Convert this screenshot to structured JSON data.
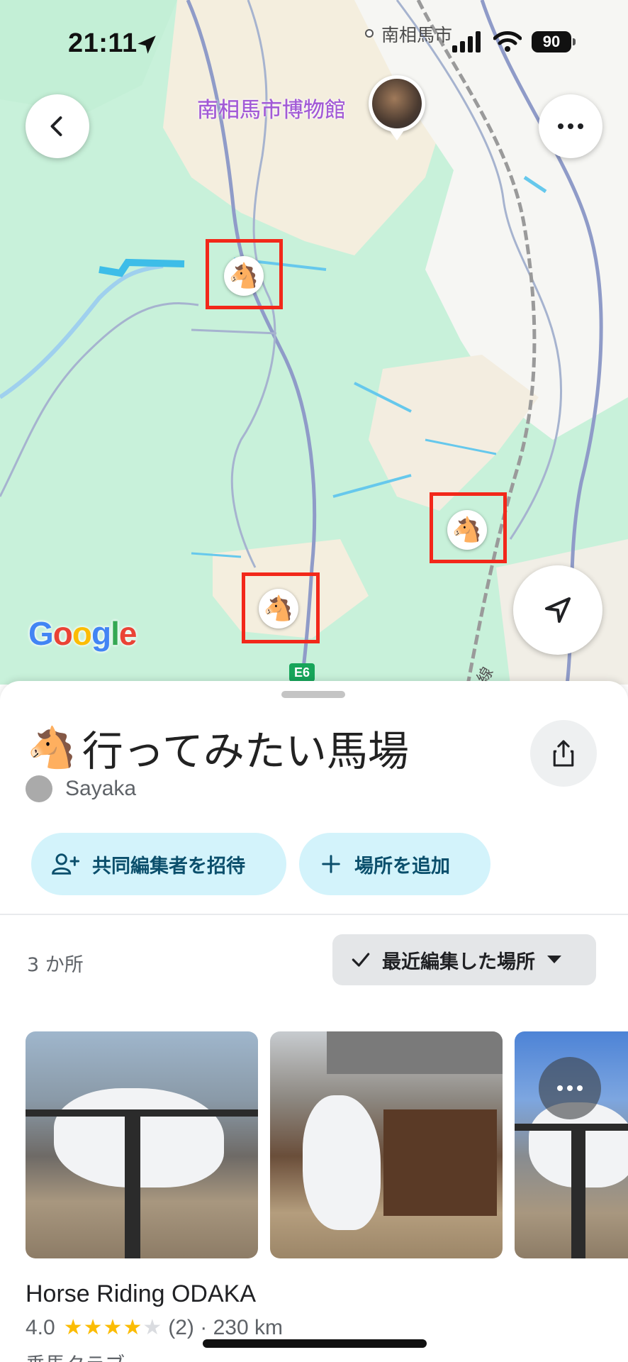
{
  "status_bar": {
    "time": "21:11",
    "battery": "90"
  },
  "map": {
    "town_label": "南相馬市",
    "museum_label": "南相馬市博物館",
    "google_logo": [
      "G",
      "o",
      "o",
      "g",
      "l",
      "e"
    ],
    "google_colors": [
      "#4285f4",
      "#ea4335",
      "#fbbc05",
      "#4285f4",
      "#34a853",
      "#ea4335"
    ],
    "highway_badge": "E6",
    "rail_label": "線",
    "pin_icon": "🐴"
  },
  "list": {
    "emoji": "🐴",
    "title": "行ってみたい馬場",
    "owner": "Sayaka",
    "invite_label": "共同編集者を招待",
    "add_place_label": "場所を追加",
    "count_label": "3 か所",
    "sort_label": "最近編集した場所"
  },
  "place": {
    "name": "Horse Riding ODAKA",
    "rating": "4.0",
    "stars_filled": 4,
    "reviews": "(2) · 230 km",
    "category": "乗馬クラブ"
  },
  "colors": {
    "accent_chip": "#d3f3fb",
    "highlight_box": "#f2281a",
    "star": "#fbbc04"
  }
}
